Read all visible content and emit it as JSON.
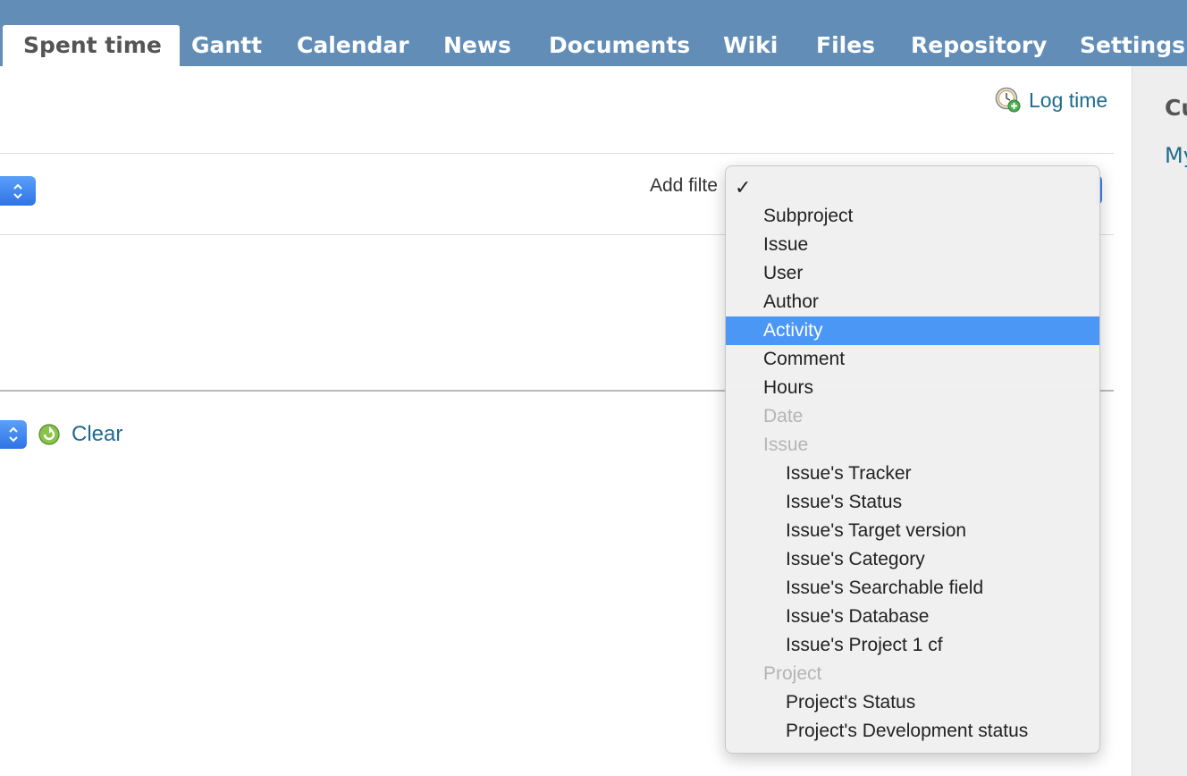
{
  "tabs": [
    "Spent time",
    "Gantt",
    "Calendar",
    "News",
    "Documents",
    "Wiki",
    "Files",
    "Repository",
    "Settings"
  ],
  "selected_tab": "Spent time",
  "log_time": "Log time",
  "add_filter_label": "Add filte",
  "clear": "Clear",
  "sidebar": {
    "heading": "Cu",
    "link": "My"
  },
  "menu": {
    "selected_value": "",
    "items": [
      {
        "label": "",
        "checked": true
      },
      {
        "label": "Subproject"
      },
      {
        "label": "Issue"
      },
      {
        "label": "User"
      },
      {
        "label": "Author"
      },
      {
        "label": "Activity",
        "highlighted": true
      },
      {
        "label": "Comment"
      },
      {
        "label": "Hours"
      },
      {
        "label": "Date",
        "disabled": true
      },
      {
        "label": "Issue",
        "disabled": true
      },
      {
        "label": "Issue's Tracker",
        "indent": true
      },
      {
        "label": "Issue's Status",
        "indent": true
      },
      {
        "label": "Issue's Target version",
        "indent": true
      },
      {
        "label": "Issue's Category",
        "indent": true
      },
      {
        "label": "Issue's Searchable field",
        "indent": true
      },
      {
        "label": "Issue's Database",
        "indent": true
      },
      {
        "label": "Issue's Project 1 cf",
        "indent": true
      },
      {
        "label": "Project",
        "disabled": true
      },
      {
        "label": "Project's Status",
        "indent": true
      },
      {
        "label": "Project's Development status",
        "indent": true
      }
    ]
  },
  "colors": {
    "tabbar": "#628db6",
    "link": "#1f6b8e",
    "highlight": "#4b97f5"
  }
}
